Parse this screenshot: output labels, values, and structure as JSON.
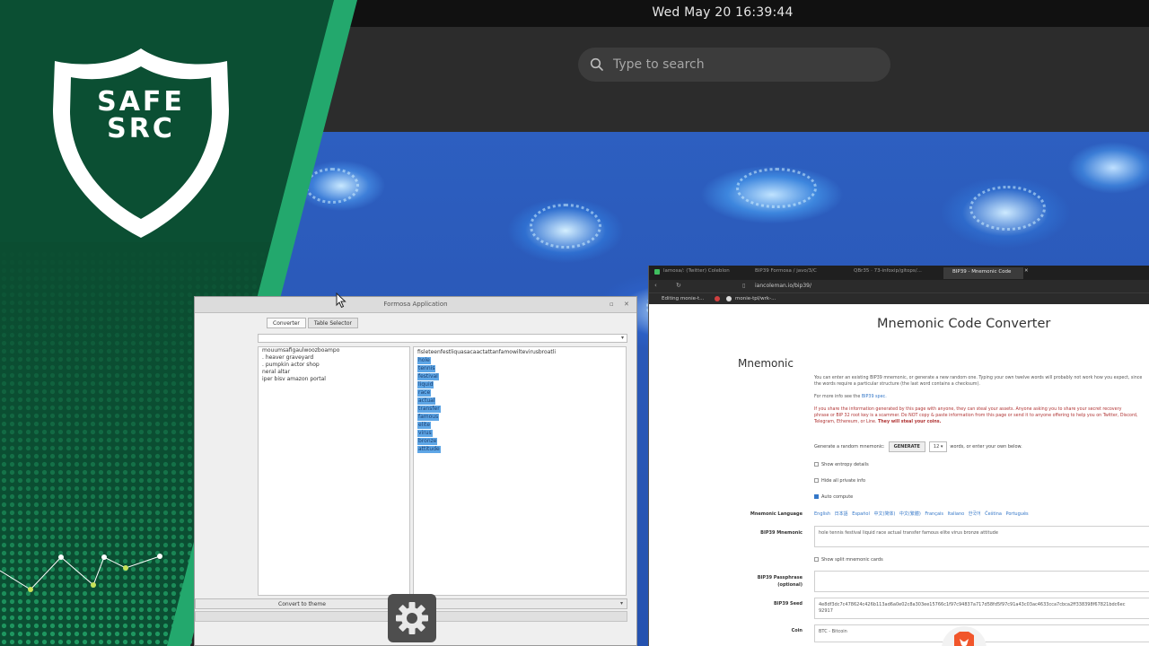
{
  "topbar": {
    "clock": "Wed May 20  16:39:44"
  },
  "overview": {
    "search_placeholder": "Type to search"
  },
  "logo": {
    "line1": "SAFE",
    "line2": "SRC"
  },
  "formosa": {
    "title": "Formosa Application",
    "tabs": [
      "Converter",
      "Table Selector"
    ],
    "left_lines": [
      "mouumsafigaulwoozboampo",
      ". heaver graveyard",
      ". pumpkin actor shop",
      "neral altar",
      "iper bisv amazon portal"
    ],
    "right_header": "fisleteenfestliquasacaactattanfamowiltevirusbroatli",
    "words": [
      "hole",
      "tennis",
      "festival",
      "liquid",
      "race",
      "actual",
      "transfer",
      "famous",
      "elite",
      "virus",
      "bronze",
      "attitude"
    ],
    "convert_label": "Convert to theme"
  },
  "browser": {
    "tabs": [
      "lamosa/: (Twitter) Coleblon",
      "BIP39 Formosa / javo/3/C",
      "QBr35 · 73-infoxip/gitops/...",
      "BIP39 - Mnemonic Code"
    ],
    "url": "iancoleman.io/bip39/",
    "bookmarks": [
      "Editing monie-t...",
      "monie-tpl/wrk-..."
    ],
    "page_title": "Mnemonic Code Converter",
    "section": "Mnemonic",
    "intro1": "You can enter an existing BIP39 mnemonic, or generate a new random one. Typing your own twelve words will probably not work how you expect, since",
    "intro2": "the words require a particular structure (the last word contains a checksum).",
    "more_info_prefix": "For more info see the",
    "more_info_link": "BIP39 spec.",
    "warn1": "If you share the information generated by this page with anyone, they can steal your assets. Anyone asking you to share your secret recovery",
    "warn2": "phrase or BIP 32 root key is a scammer. Do NOT copy & paste information from this page or send it to anyone offering to help you on Twitter, Discord,",
    "warn3a": "Telegram, Ethereum, or Line.",
    "warn3b": "They will steal your coins.",
    "generate_prefix": "Generate a random mnemonic:",
    "generate_button": "GENERATE",
    "word_count": "12",
    "generate_suffix": "words, or enter your own below.",
    "checkbox_entropy": "Show entropy details",
    "checkbox_hide": "Hide all private info",
    "checkbox_auto": "Auto compute",
    "label_language": "Mnemonic Language",
    "languages": "English 日本語 Español 中文(简体) 中文(繁體) Français Italiano 한국어 Čeština Português",
    "label_mnemonic": "BIP39 Mnemonic",
    "mnemonic_value": "hole tennis festival liquid race actual transfer famous elite virus bronze attitude",
    "checkbox_split": "Show split mnemonic cards",
    "label_passphrase": "BIP39 Passphrase",
    "label_passphrase2": "(optional)",
    "label_seed": "BIP39 Seed",
    "seed_value": "4e8df3dc7c478624c426b113ad6a0e02c8a303ee15766c1f97c94837a717d58fd5f97c91a43c03ac4633cca7cbca2ff338398f67821bdc6ec",
    "seed_value2": "92917",
    "label_coin": "Coin",
    "coin_value": "BTC - Bitcoin"
  }
}
